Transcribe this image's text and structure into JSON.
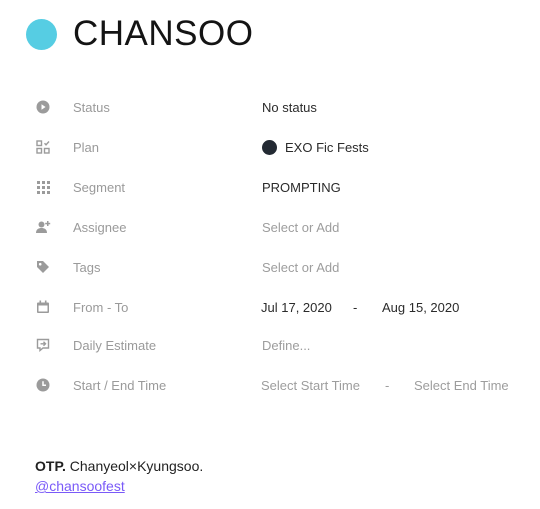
{
  "header": {
    "title": "CHANSOO",
    "dot_color": "#56cde3"
  },
  "properties": {
    "status": {
      "label": "Status",
      "value": "No status",
      "icon": "status-icon"
    },
    "plan": {
      "label": "Plan",
      "value": "EXO Fic Fests",
      "icon": "plan-icon",
      "dot_color": "#232a33"
    },
    "segment": {
      "label": "Segment",
      "value": "PROMPTING",
      "icon": "segment-grid-icon"
    },
    "assignee": {
      "label": "Assignee",
      "placeholder": "Select or Add",
      "icon": "assignee-icon"
    },
    "tags": {
      "label": "Tags",
      "placeholder": "Select or Add",
      "icon": "tag-icon"
    },
    "date_range": {
      "label": "From - To",
      "from": "Jul 17, 2020",
      "separator": "-",
      "to": "Aug 15, 2020",
      "icon": "calendar-icon"
    },
    "daily": {
      "label": "Daily Estimate",
      "placeholder": "Define...",
      "icon": "estimate-icon"
    },
    "time": {
      "label": "Start / End Time",
      "start_placeholder": "Select Start Time",
      "separator": "-",
      "end_placeholder": "Select End Time",
      "icon": "clock-icon"
    }
  },
  "footer": {
    "otp_label": "OTP.",
    "otp_text": "Chanyeol×Kyungsoo.",
    "link": "@chansoofest",
    "link_color": "#7a5af8"
  }
}
